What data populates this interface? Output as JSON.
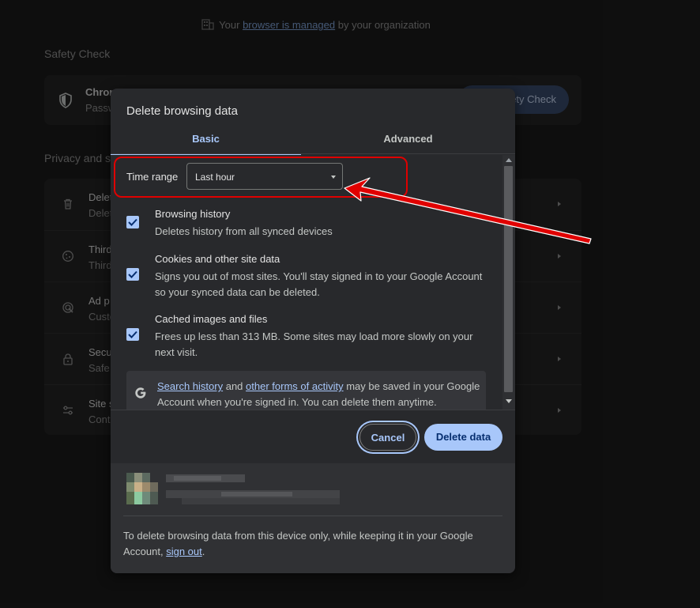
{
  "background": {
    "managed": {
      "prefix": "Your",
      "link": "browser is managed",
      "suffix": "by your organization"
    },
    "safety_check": {
      "section_title": "Safety Check",
      "title": "Chrom",
      "subtitle": "Passw",
      "button": "ety Check"
    },
    "privacy": {
      "section_title": "Privacy and s",
      "rows": [
        {
          "title": "Delet",
          "subtitle": "Delet",
          "icon": "trash-icon"
        },
        {
          "title": "Third",
          "subtitle": "Third",
          "icon": "cookie-icon"
        },
        {
          "title": "Ad p",
          "subtitle": "Custo",
          "icon": "ad-privacy-icon"
        },
        {
          "title": "Secu",
          "subtitle": "Safe",
          "icon": "lock-icon"
        },
        {
          "title": "Site s",
          "subtitle": "Cont",
          "icon": "sliders-icon"
        }
      ]
    }
  },
  "dialog": {
    "title": "Delete browsing data",
    "tabs": [
      {
        "label": "Basic",
        "selected": true
      },
      {
        "label": "Advanced",
        "selected": false
      }
    ],
    "time_range": {
      "label": "Time range",
      "value": "Last hour"
    },
    "options": [
      {
        "title": "Browsing history",
        "description": "Deletes history from all synced devices",
        "checked": true
      },
      {
        "title": "Cookies and other site data",
        "description": "Signs you out of most sites. You'll stay signed in to your Google Account so your synced data can be deleted.",
        "checked": true
      },
      {
        "title": "Cached images and files",
        "description": "Frees up less than 313 MB. Some sites may load more slowly on your next visit.",
        "checked": true
      }
    ],
    "google_notice": {
      "link1": "Search history",
      "and": "and",
      "link2": "other forms of activity",
      "rest": "may be saved in your Google Account when you're signed in. You can delete them anytime."
    },
    "buttons": {
      "cancel": "Cancel",
      "delete": "Delete data"
    },
    "footer": {
      "text": "To delete browsing data from this device only, while keeping it in your Google Account,",
      "link": "sign out",
      "end": "."
    }
  },
  "colors": {
    "accent": "#a8c7fa",
    "annotation": "#e00000"
  }
}
